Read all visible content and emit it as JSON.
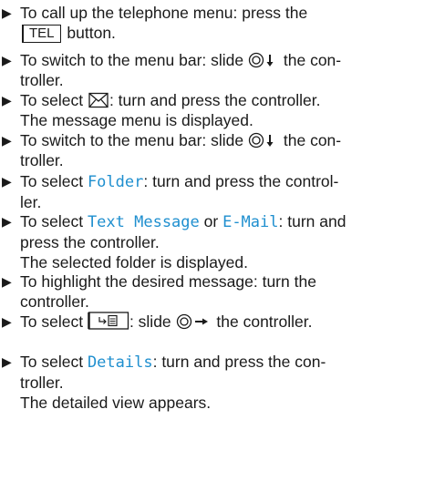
{
  "steps": [
    {
      "pre": "To call up the telephone menu: press the",
      "key": "TEL",
      "post": "button."
    },
    {
      "pre": "To switch to the menu bar: slide",
      "post1": "the con-",
      "post2": "troller."
    },
    {
      "pre": "To select",
      "post": ": turn and press the controller.",
      "result": "The message menu is displayed."
    },
    {
      "pre": "To switch to the menu bar: slide",
      "post1": "the con-",
      "post2": "troller."
    },
    {
      "pre": "To select",
      "item": "Folder",
      "post1": ": turn and press the control-",
      "post2": "ler."
    },
    {
      "pre": "To select",
      "item1": "Text Message",
      "mid": "or",
      "item2": "E-Mail",
      "post1": ": turn and",
      "post2": "press the controller.",
      "result": "The selected folder is displayed."
    },
    {
      "line1": "To highlight the desired message: turn the",
      "line2": "controller."
    },
    {
      "pre": "To select",
      "post": ": slide",
      "post_end": "the controller."
    },
    {
      "pre": "To select",
      "item": "Details",
      "post1": ": turn and press the con-",
      "post2": "troller.",
      "result": "The detailed view appears."
    }
  ],
  "icons": {
    "bullet": "triangle-bullet",
    "controller": "controller-knob",
    "slide_down": "arrow-down",
    "slide_right": "arrow-right",
    "message": "envelope",
    "details_key": "details-key"
  }
}
